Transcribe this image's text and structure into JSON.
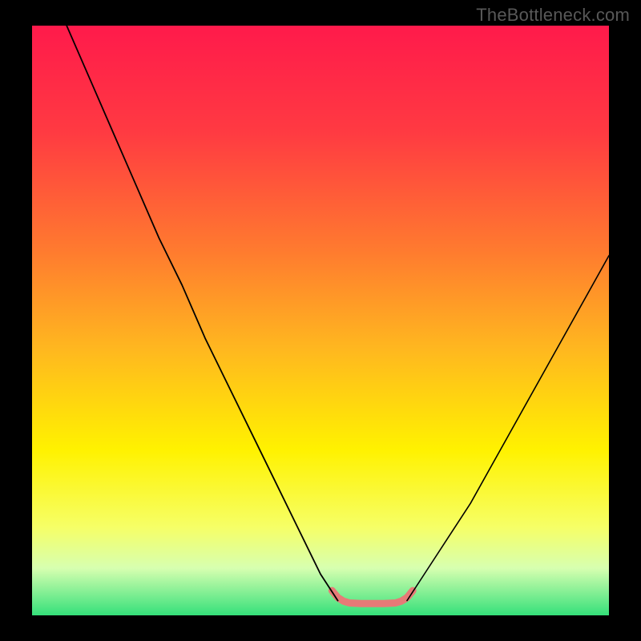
{
  "site_watermark": "TheBottleneck.com",
  "chart_data": {
    "type": "line",
    "title": "",
    "xlabel": "",
    "ylabel": "",
    "xlim": [
      0,
      100
    ],
    "ylim": [
      0,
      100
    ],
    "grid": false,
    "legend": false,
    "background_gradient_stops": [
      {
        "offset": 0,
        "color": "#ff1a4b"
      },
      {
        "offset": 18,
        "color": "#ff3a42"
      },
      {
        "offset": 38,
        "color": "#ff7a2f"
      },
      {
        "offset": 55,
        "color": "#ffb81f"
      },
      {
        "offset": 72,
        "color": "#fff200"
      },
      {
        "offset": 85,
        "color": "#f6ff66"
      },
      {
        "offset": 92,
        "color": "#d7ffb0"
      },
      {
        "offset": 100,
        "color": "#35e07a"
      }
    ],
    "series": [
      {
        "name": "left-branch",
        "stroke": "#000000",
        "stroke_width": 1.8,
        "x": [
          6,
          10,
          14,
          18,
          22,
          26,
          30,
          34,
          38,
          42,
          46,
          50,
          53
        ],
        "y": [
          100,
          91,
          82,
          73,
          64,
          56,
          47,
          39,
          31,
          23,
          15,
          7,
          2.5
        ]
      },
      {
        "name": "right-branch",
        "stroke": "#000000",
        "stroke_width": 1.6,
        "x": [
          65,
          68,
          72,
          76,
          80,
          84,
          88,
          92,
          96,
          100
        ],
        "y": [
          2.5,
          7,
          13,
          19,
          26,
          33,
          40,
          47,
          54,
          61
        ]
      },
      {
        "name": "valley-bottom",
        "stroke": "#e77a77",
        "stroke_width": 9,
        "x": [
          52,
          53,
          54,
          55,
          57,
          59,
          61,
          63,
          64,
          65,
          66
        ],
        "y": [
          4.2,
          3.0,
          2.4,
          2.1,
          2.0,
          2.0,
          2.0,
          2.1,
          2.4,
          3.0,
          4.2
        ]
      }
    ]
  }
}
